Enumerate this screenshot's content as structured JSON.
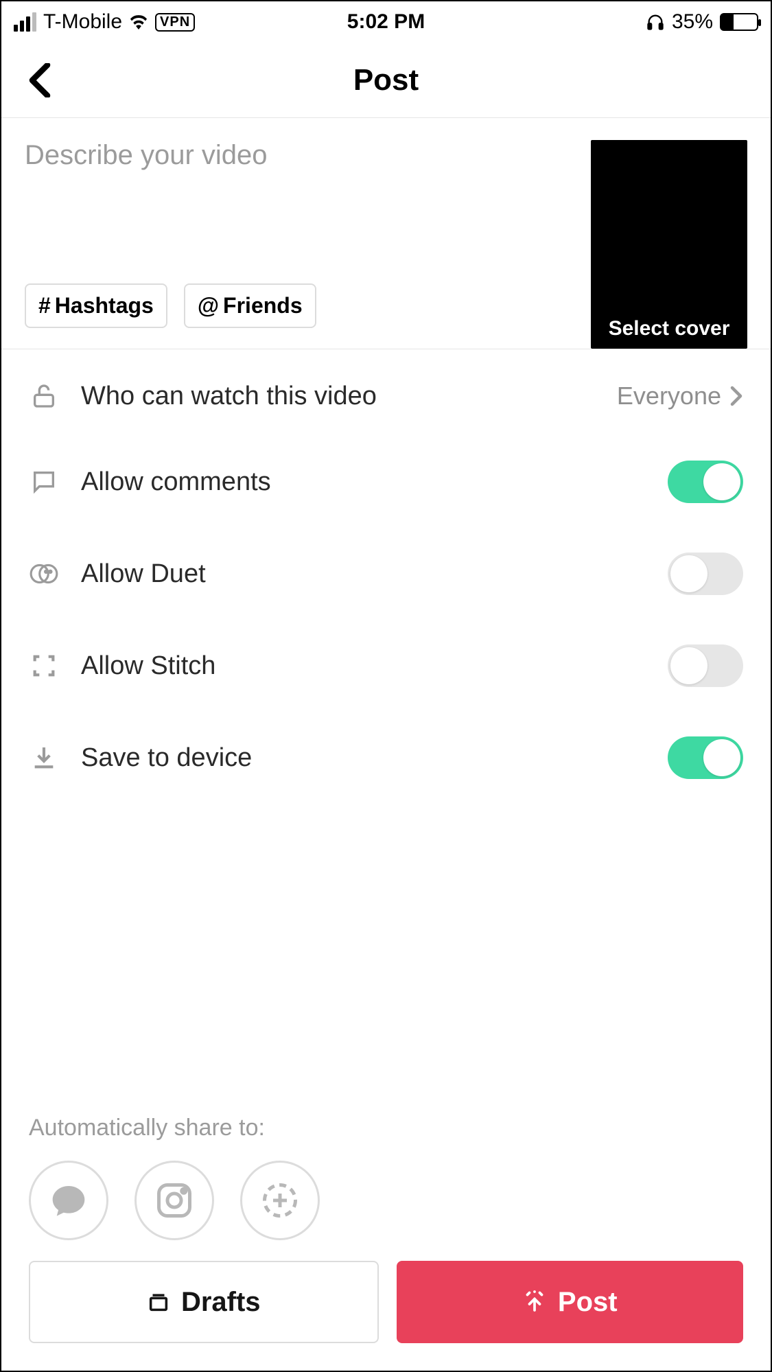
{
  "status": {
    "carrier": "T-Mobile",
    "vpn": "VPN",
    "time": "5:02 PM",
    "battery_pct": "35%"
  },
  "nav": {
    "title": "Post"
  },
  "describe": {
    "placeholder": "Describe your video",
    "hashtags_label": "Hashtags",
    "friends_label": "Friends",
    "cover_label": "Select cover"
  },
  "settings": {
    "privacy": {
      "label": "Who can watch this video",
      "value": "Everyone"
    },
    "comments": {
      "label": "Allow comments",
      "on": true
    },
    "duet": {
      "label": "Allow Duet",
      "on": false
    },
    "stitch": {
      "label": "Allow Stitch",
      "on": false
    },
    "save": {
      "label": "Save to device",
      "on": true
    }
  },
  "share": {
    "label": "Automatically share to:"
  },
  "bottom": {
    "drafts": "Drafts",
    "post": "Post"
  }
}
